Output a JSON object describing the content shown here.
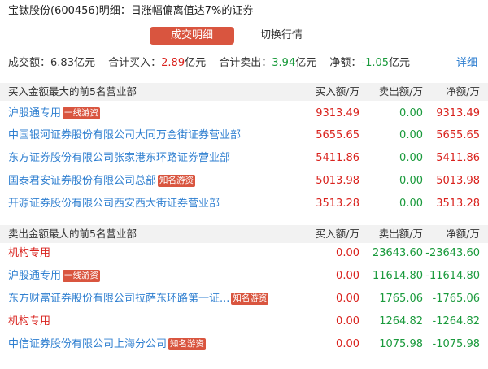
{
  "title": "宝钛股份(600456)明细：日涨幅偏离值达7%的证券",
  "tabs": [
    {
      "label": "成交明细",
      "active": true
    },
    {
      "label": "切换行情",
      "active": false
    }
  ],
  "summary": {
    "volume_label": "成交额：",
    "volume_value": "6.83",
    "volume_unit": "亿元",
    "buy_label": "合计买入：",
    "buy_value": "2.89",
    "buy_unit": "亿元",
    "sell_label": "合计卖出：",
    "sell_value": "3.94",
    "sell_unit": "亿元",
    "net_label": "净额：",
    "net_value": "-1.05",
    "net_unit": "亿元",
    "detail_link": "详细"
  },
  "buy_section": {
    "header": "买入金额最大的前5名营业部",
    "col_buy": "买入额/万",
    "col_sell": "卖出额/万",
    "col_net": "净额/万",
    "rows": [
      {
        "name": "沪股通专用",
        "tag": "一线游资",
        "buy": "9313.49",
        "sell": "0.00",
        "net": "9313.49"
      },
      {
        "name": "中国银河证券股份有限公司大同万金街证券营业部",
        "tag": "",
        "buy": "5655.65",
        "sell": "0.00",
        "net": "5655.65"
      },
      {
        "name": "东方证券股份有限公司张家港东环路证券营业部",
        "tag": "",
        "buy": "5411.86",
        "sell": "0.00",
        "net": "5411.86"
      },
      {
        "name": "国泰君安证券股份有限公司总部",
        "tag": "知名游资",
        "buy": "5013.98",
        "sell": "0.00",
        "net": "5013.98"
      },
      {
        "name": "开源证券股份有限公司西安西大街证券营业部",
        "tag": "",
        "buy": "3513.28",
        "sell": "0.00",
        "net": "3513.28"
      }
    ]
  },
  "sell_section": {
    "header": "卖出金额最大的前5名营业部",
    "col_buy": "买入额/万",
    "col_sell": "卖出额/万",
    "col_net": "净额/万",
    "rows": [
      {
        "name": "机构专用",
        "tag": "",
        "buy": "0.00",
        "sell": "23643.60",
        "net": "-23643.60",
        "name_red": true
      },
      {
        "name": "沪股通专用",
        "tag": "一线游资",
        "buy": "0.00",
        "sell": "11614.80",
        "net": "-11614.80",
        "name_red": false
      },
      {
        "name": "东方财富证券股份有限公司拉萨东环路第一证...",
        "tag": "知名游资",
        "buy": "0.00",
        "sell": "1765.06",
        "net": "-1765.06",
        "name_red": false
      },
      {
        "name": "机构专用",
        "tag": "",
        "buy": "0.00",
        "sell": "1264.82",
        "net": "-1264.82",
        "name_red": true
      },
      {
        "name": "中信证券股份有限公司上海分公司",
        "tag": "知名游资",
        "buy": "0.00",
        "sell": "1075.98",
        "net": "-1075.98",
        "name_red": false
      }
    ]
  }
}
